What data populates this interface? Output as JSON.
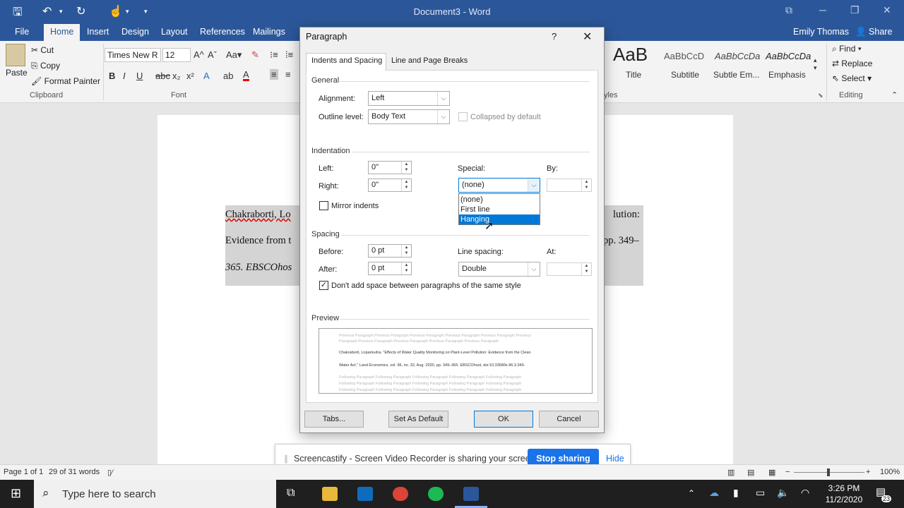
{
  "window": {
    "title": "Document3  -  Word",
    "accent": "#2b579a"
  },
  "ribbon_tabs": [
    "File",
    "Home",
    "Insert",
    "Design",
    "Layout",
    "References",
    "Mailings"
  ],
  "active_tab": "Home",
  "account": {
    "user": "Emily Thomas",
    "share": "Share"
  },
  "clipboard": {
    "paste": "Paste",
    "cut": "Cut",
    "copy": "Copy",
    "format_painter": "Format Painter",
    "label": "Clipboard"
  },
  "font_group": {
    "font_name": "Times New R",
    "font_size": "12",
    "label": "Font"
  },
  "styles": {
    "items": [
      {
        "sample": "AaB",
        "name": "Title"
      },
      {
        "sample": "AaBbCcD",
        "name": "Subtitle"
      },
      {
        "sample": "AaBbCcDa",
        "name": "Subtle Em..."
      },
      {
        "sample": "AaBbCcDa",
        "name": "Emphasis"
      }
    ],
    "label": "tyles"
  },
  "editing": {
    "find": "Find",
    "replace": "Replace",
    "select": "Select",
    "label": "Editing"
  },
  "document": {
    "lines": [
      {
        "left": "Chakraborti, Lo",
        "right": "lution:"
      },
      {
        "left": "Evidence from t",
        "right": "pp. 349–"
      },
      {
        "left": "365. EBSCOhos",
        "right": ""
      }
    ]
  },
  "dialog": {
    "title": "Paragraph",
    "help": "?",
    "tabs": [
      "Indents and Spacing",
      "Line and Page Breaks"
    ],
    "general": {
      "heading": "General",
      "alignment_label": "Alignment:",
      "alignment_value": "Left",
      "outline_label": "Outline level:",
      "outline_value": "Body Text",
      "collapsed_label": "Collapsed by default"
    },
    "indentation": {
      "heading": "Indentation",
      "left_label": "Left:",
      "left_value": "0\"",
      "right_label": "Right:",
      "right_value": "0\"",
      "special_label": "Special:",
      "special_value": "(none)",
      "by_label": "By:",
      "mirror_label": "Mirror indents",
      "special_options": [
        "(none)",
        "First line",
        "Hanging"
      ],
      "highlighted_option": "Hanging"
    },
    "spacing": {
      "heading": "Spacing",
      "before_label": "Before:",
      "before_value": "0 pt",
      "after_label": "After:",
      "after_value": "0 pt",
      "line_spacing_label": "Line spacing:",
      "line_spacing_value": "Double",
      "at_label": "At:",
      "dont_add_label": "Don't add space between paragraphs of the same style",
      "dont_add_checked": true
    },
    "preview": {
      "heading": "Preview",
      "prev_lines": [
        "Previous Paragraph Previous Paragraph Previous Paragraph Previous Paragraph Previous Paragraph Previous",
        "Paragraph Previous Paragraph Previous Paragraph Previous Paragraph Previous Paragraph"
      ],
      "sample_lines": [
        "Chakraborti, Lopamudra. \"Effects of Water Quality Monitoring on Plant-Level Pollution: Evidence from the Clean",
        "Water Act.\" Land Economics, vol. 96, no. 32, Aug. 2020, pp. 349–365. EBSCOhost, doi:10.3368/le.96.3.349."
      ],
      "next_lines": [
        "Following Paragraph Following Paragraph Following Paragraph Following Paragraph Following Paragraph",
        "Following Paragraph Following Paragraph Following Paragraph Following Paragraph Following Paragraph",
        "Following Paragraph Following Paragraph Following Paragraph Following Paragraph Following Paragraph"
      ]
    },
    "buttons": {
      "tabs": "Tabs...",
      "set_default": "Set As Default",
      "ok": "OK",
      "cancel": "Cancel"
    }
  },
  "screencastify": {
    "message": "Screencastify - Screen Video Recorder is sharing your screen.",
    "stop": "Stop sharing",
    "hide": "Hide"
  },
  "statusbar": {
    "page": "Page 1 of 1",
    "words": "29 of 31 words",
    "zoom": "100%"
  },
  "taskbar": {
    "search_placeholder": "Type here to search",
    "time": "3:26 PM",
    "date": "11/2/2020",
    "notification_count": "23"
  }
}
